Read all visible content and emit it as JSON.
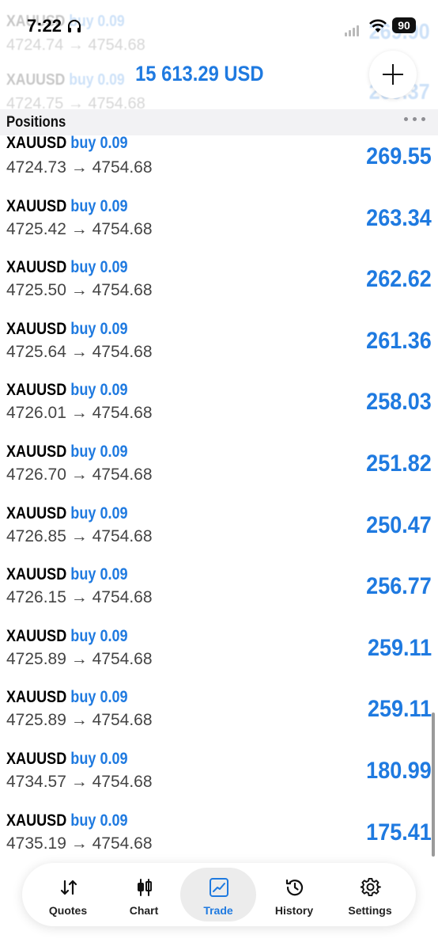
{
  "status": {
    "time": "7:22",
    "battery": "90"
  },
  "header": {
    "balance": "15 613.29 USD"
  },
  "ghost_rows": [
    {
      "symbol": "XAUUSD",
      "side": "buy",
      "volume": "0.09",
      "open": "4724.74",
      "current": "4754.68",
      "profit": "269.90"
    },
    {
      "symbol": "XAUUSD",
      "side": "buy",
      "volume": "0.09",
      "open": "4724.75",
      "current": "4754.68",
      "profit": "269.37"
    }
  ],
  "section": {
    "title": "Positions"
  },
  "arrow": "→",
  "positions": [
    {
      "symbol": "XAUUSD",
      "side": "buy",
      "volume": "0.09",
      "open": "4724.73",
      "current": "4754.68",
      "profit": "269.55"
    },
    {
      "symbol": "XAUUSD",
      "side": "buy",
      "volume": "0.09",
      "open": "4725.42",
      "current": "4754.68",
      "profit": "263.34"
    },
    {
      "symbol": "XAUUSD",
      "side": "buy",
      "volume": "0.09",
      "open": "4725.50",
      "current": "4754.68",
      "profit": "262.62"
    },
    {
      "symbol": "XAUUSD",
      "side": "buy",
      "volume": "0.09",
      "open": "4725.64",
      "current": "4754.68",
      "profit": "261.36"
    },
    {
      "symbol": "XAUUSD",
      "side": "buy",
      "volume": "0.09",
      "open": "4726.01",
      "current": "4754.68",
      "profit": "258.03"
    },
    {
      "symbol": "XAUUSD",
      "side": "buy",
      "volume": "0.09",
      "open": "4726.70",
      "current": "4754.68",
      "profit": "251.82"
    },
    {
      "symbol": "XAUUSD",
      "side": "buy",
      "volume": "0.09",
      "open": "4726.85",
      "current": "4754.68",
      "profit": "250.47"
    },
    {
      "symbol": "XAUUSD",
      "side": "buy",
      "volume": "0.09",
      "open": "4726.15",
      "current": "4754.68",
      "profit": "256.77"
    },
    {
      "symbol": "XAUUSD",
      "side": "buy",
      "volume": "0.09",
      "open": "4725.89",
      "current": "4754.68",
      "profit": "259.11"
    },
    {
      "symbol": "XAUUSD",
      "side": "buy",
      "volume": "0.09",
      "open": "4725.89",
      "current": "4754.68",
      "profit": "259.11"
    },
    {
      "symbol": "XAUUSD",
      "side": "buy",
      "volume": "0.09",
      "open": "4734.57",
      "current": "4754.68",
      "profit": "180.99"
    },
    {
      "symbol": "XAUUSD",
      "side": "buy",
      "volume": "0.09",
      "open": "4735.19",
      "current": "4754.68",
      "profit": "175.41"
    }
  ],
  "tabs": [
    {
      "label": "Quotes",
      "icon": "quotes-icon"
    },
    {
      "label": "Chart",
      "icon": "chart-icon"
    },
    {
      "label": "Trade",
      "icon": "trade-icon",
      "active": true
    },
    {
      "label": "History",
      "icon": "history-icon"
    },
    {
      "label": "Settings",
      "icon": "settings-icon"
    }
  ],
  "colors": {
    "accent": "#1f7ae0",
    "text": "#111111",
    "muted": "#444444",
    "section_bg": "#f2f2f4"
  }
}
